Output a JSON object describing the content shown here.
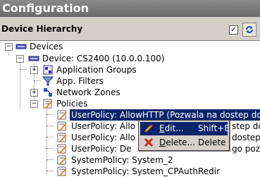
{
  "window": {
    "title": "Configuration"
  },
  "panel": {
    "title": "Device Hierarchy",
    "checkbox_checked": true
  },
  "tree": {
    "root": "Devices",
    "device": "Device: CS2400 (10.0.0.100)",
    "app_groups": "Application Groups",
    "app_filters": "App. Filters",
    "network_zones": "Network Zones",
    "policies": "Policies",
    "policy_items": [
      "UserPolicy: AllowHTTP (Pozwala na dostep do H",
      "UserPolicy: Allo",
      "UserPolicy: Allo",
      "UserPolicy: De",
      "SystemPolicy: System_2",
      "SystemPolicy: System_CPAuthRedir"
    ],
    "policy_tails": [
      "",
      "step do",
      "dostep",
      "go poz",
      "",
      ""
    ]
  },
  "context_menu": {
    "edit_prefix": "",
    "edit_u": "E",
    "edit_rest": "dit...",
    "edit_shortcut": "Shift+E",
    "delete_u": "D",
    "delete_rest": "elete...",
    "delete_shortcut": "Delete"
  },
  "colors": {
    "selection": "#0a246a",
    "titlebar": "#7a7a7a"
  }
}
